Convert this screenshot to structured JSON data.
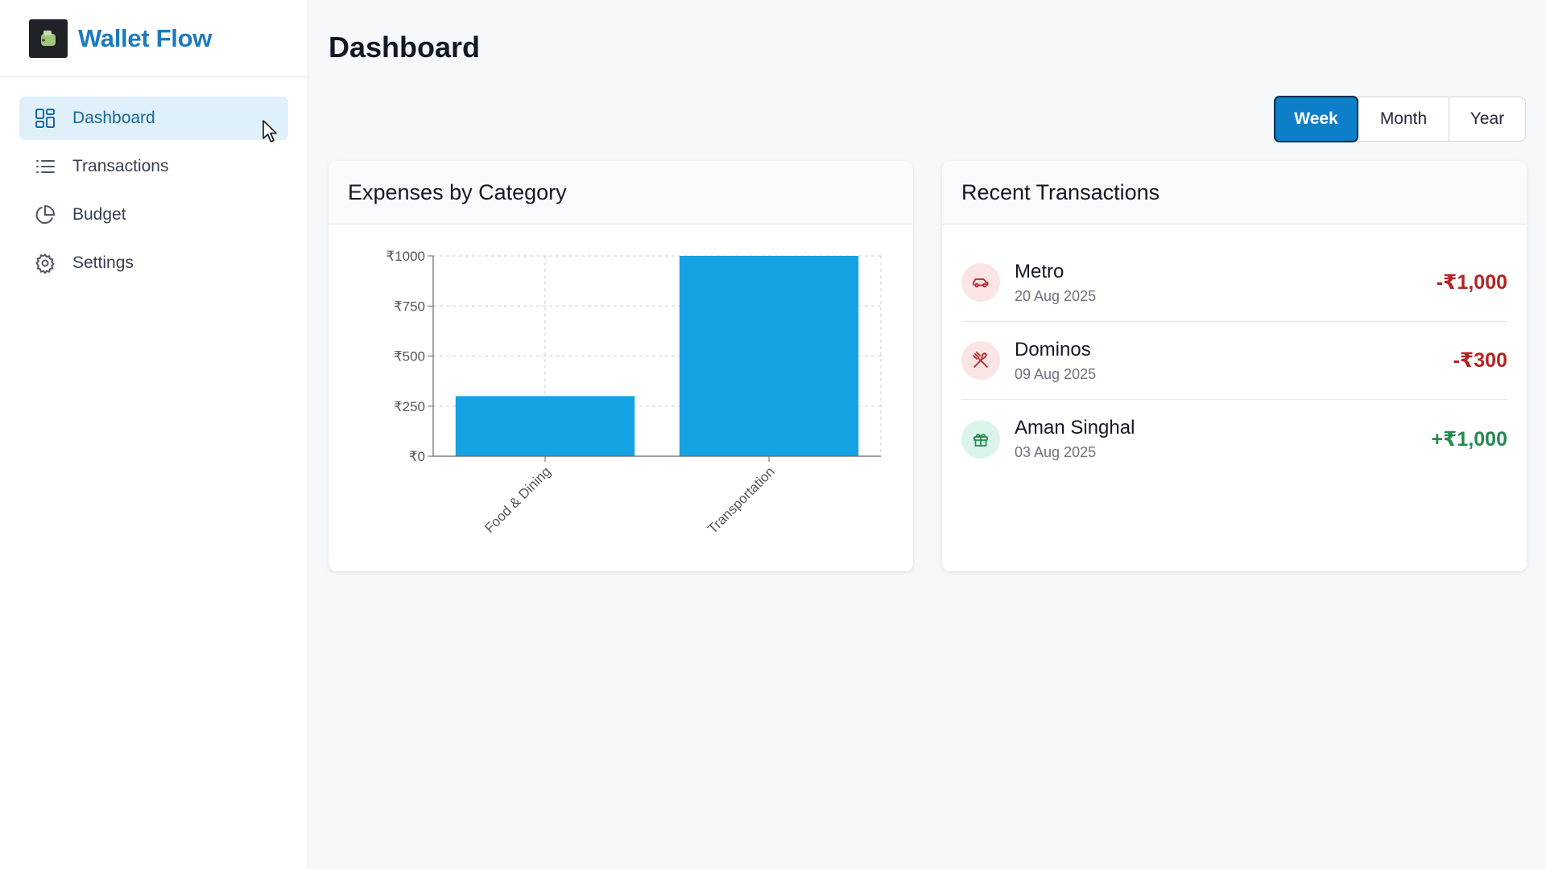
{
  "app": {
    "name": "Wallet Flow"
  },
  "sidebar": {
    "items": [
      {
        "label": "Dashboard",
        "icon": "dashboard-grid-icon",
        "active": true
      },
      {
        "label": "Transactions",
        "icon": "list-icon",
        "active": false
      },
      {
        "label": "Budget",
        "icon": "pie-chart-icon",
        "active": false
      },
      {
        "label": "Settings",
        "icon": "gear-icon",
        "active": false
      }
    ]
  },
  "page": {
    "title": "Dashboard"
  },
  "range": {
    "options": [
      "Week",
      "Month",
      "Year"
    ],
    "selected": "Week"
  },
  "expenses_card": {
    "title": "Expenses by Category"
  },
  "transactions_card": {
    "title": "Recent Transactions",
    "items": [
      {
        "name": "Metro",
        "date": "20 Aug 2025",
        "amount": "-₹1,000",
        "type": "expense",
        "icon": "car-icon"
      },
      {
        "name": "Dominos",
        "date": "09 Aug 2025",
        "amount": "-₹300",
        "type": "expense",
        "icon": "utensils-icon"
      },
      {
        "name": "Aman Singhal",
        "date": "03 Aug 2025",
        "amount": "+₹1,000",
        "type": "income",
        "icon": "gift-icon"
      }
    ]
  },
  "colors": {
    "accent": "#0d7fc9",
    "brand": "#1a7bbf",
    "bar": "#16a3e4",
    "expense": "#b42323",
    "income": "#238a4e"
  },
  "chart_data": {
    "type": "bar",
    "title": "Expenses by Category",
    "categories": [
      "Food & Dining",
      "Transportation"
    ],
    "values": [
      300,
      1000
    ],
    "yticks": [
      "₹0",
      "₹250",
      "₹500",
      "₹750",
      "₹1000"
    ],
    "ylim": [
      0,
      1000
    ],
    "grid": true,
    "xlabel": "",
    "ylabel": ""
  }
}
